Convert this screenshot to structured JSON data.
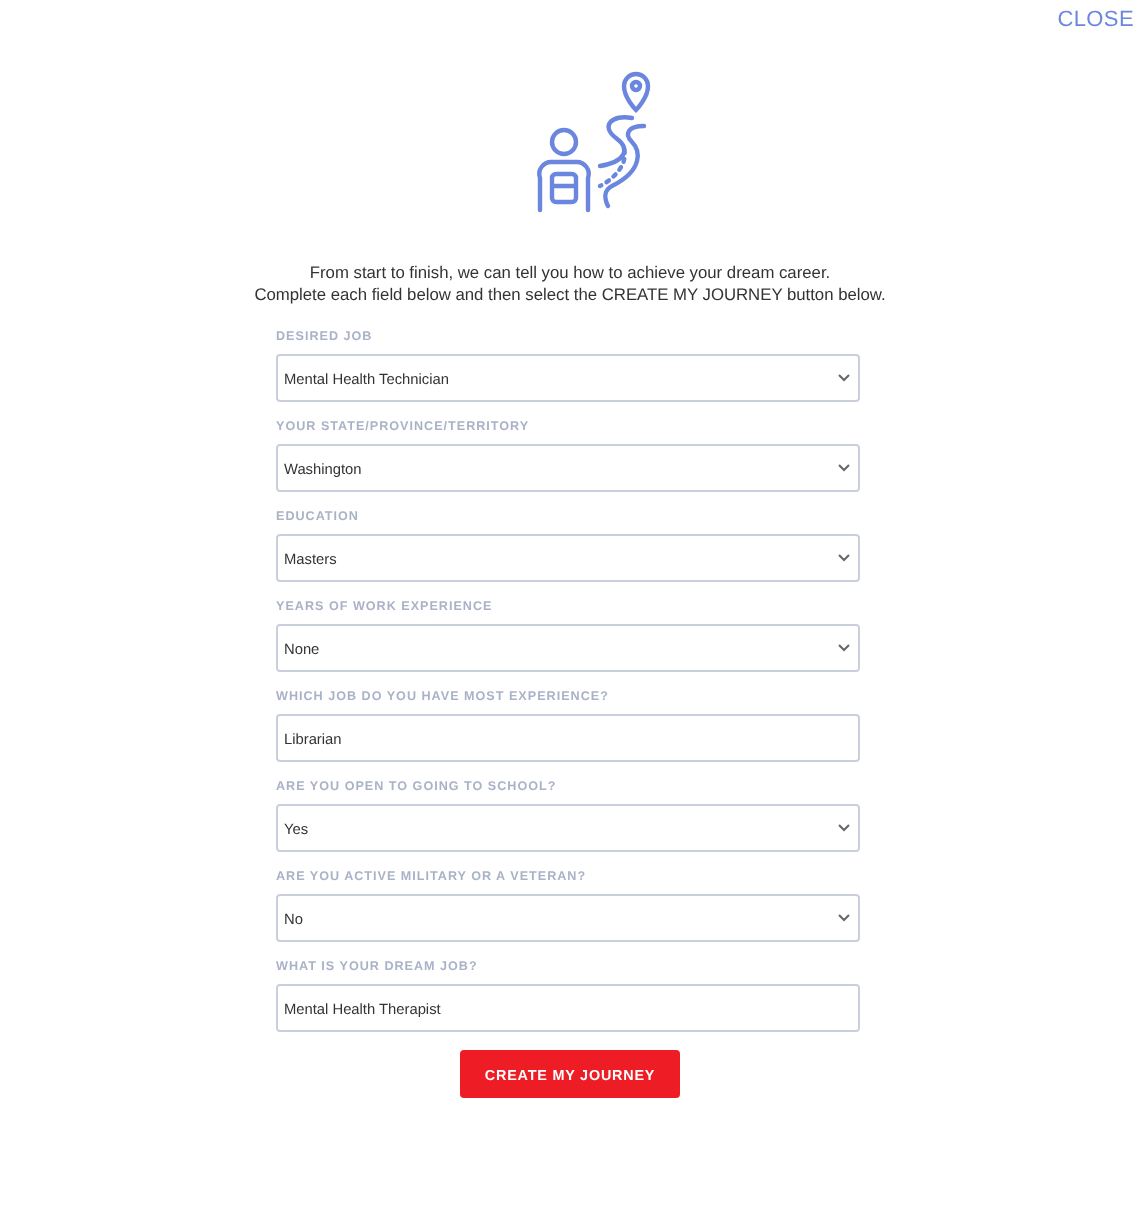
{
  "close_link": "CLOSE",
  "intro": [
    "From start to finish, we can tell you how to achieve your dream career.",
    "Complete each field below and then select the CREATE MY JOURNEY button below."
  ],
  "fields": [
    {
      "label": "DESIRED JOB",
      "kind": "select",
      "value": "Mental Health Technician"
    },
    {
      "label": "YOUR STATE/PROVINCE/TERRITORY",
      "kind": "select",
      "value": "Washington"
    },
    {
      "label": "EDUCATION",
      "kind": "select",
      "value": "Masters"
    },
    {
      "label": "YEARS OF WORK EXPERIENCE",
      "kind": "select",
      "value": "None"
    },
    {
      "label": "WHICH JOB DO YOU HAVE MOST EXPERIENCE?",
      "kind": "text",
      "value": "Librarian"
    },
    {
      "label": "ARE YOU OPEN TO GOING TO SCHOOL?",
      "kind": "select",
      "value": "Yes"
    },
    {
      "label": "ARE YOU ACTIVE MILITARY OR A VETERAN?",
      "kind": "select",
      "value": "No"
    },
    {
      "label": "WHAT IS YOUR DREAM JOB?",
      "kind": "text",
      "value": "Mental Health Therapist"
    }
  ],
  "submit_button": "CREATE MY JOURNEY"
}
